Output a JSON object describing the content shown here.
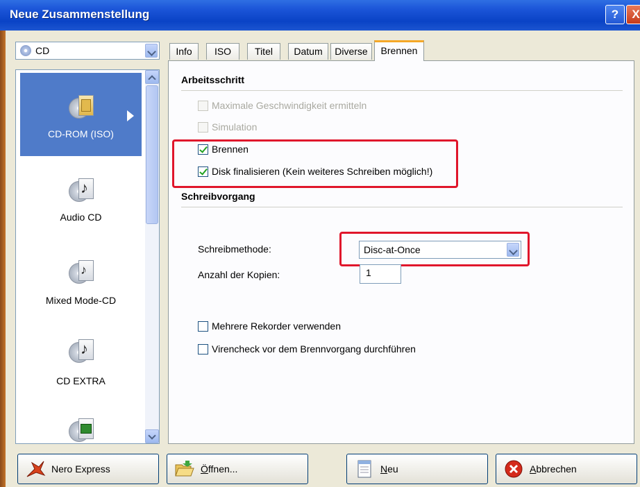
{
  "window": {
    "title": "Neue Zusammenstellung"
  },
  "titlebar_buttons": {
    "help": "?",
    "close": "X"
  },
  "disc_select": {
    "value": "CD"
  },
  "types": [
    {
      "label": "CD-ROM (ISO)",
      "icon": "cd-rom-iso-icon",
      "selected": true
    },
    {
      "label": "Audio CD",
      "icon": "audio-cd-icon",
      "selected": false
    },
    {
      "label": "Mixed Mode-CD",
      "icon": "mixed-mode-cd-icon",
      "selected": false
    },
    {
      "label": "CD EXTRA",
      "icon": "cd-extra-icon",
      "selected": false
    },
    {
      "label": "",
      "icon": "video-cd-icon",
      "selected": false
    }
  ],
  "tabs": [
    {
      "label": "Info",
      "active": false
    },
    {
      "label": "ISO",
      "active": false
    },
    {
      "label": "Titel",
      "active": false
    },
    {
      "label": "Datum",
      "active": false
    },
    {
      "label": "Diverse",
      "active": false
    },
    {
      "label": "Brennen",
      "active": true
    }
  ],
  "panel": {
    "section1_title": "Arbeitsschritt",
    "options": [
      {
        "label": "Maximale Geschwindigkeit ermitteln",
        "checked": false,
        "enabled": false
      },
      {
        "label": "Simulation",
        "checked": false,
        "enabled": false
      },
      {
        "label": "Brennen",
        "checked": true,
        "enabled": true
      },
      {
        "label": "Disk finalisieren (Kein weiteres Schreiben möglich!)",
        "checked": true,
        "enabled": true
      }
    ],
    "section2_title": "Schreibvorgang",
    "write_method_label": "Schreibmethode:",
    "write_method_value": "Disc-at-Once",
    "copies_label": "Anzahl der Kopien:",
    "copies_value": "1",
    "extra_options": [
      {
        "label": "Mehrere Rekorder verwenden",
        "checked": false
      },
      {
        "label": "Virencheck vor dem Brennvorgang durchführen",
        "checked": false
      }
    ]
  },
  "buttons": {
    "nero_express": "Nero Express",
    "open": "Öffnen...",
    "new": "Neu",
    "cancel": "Abbrechen"
  },
  "colors": {
    "highlight_box": "#e0162b",
    "selection": "#4f7bc9",
    "titlebar": "#0a43c6"
  }
}
